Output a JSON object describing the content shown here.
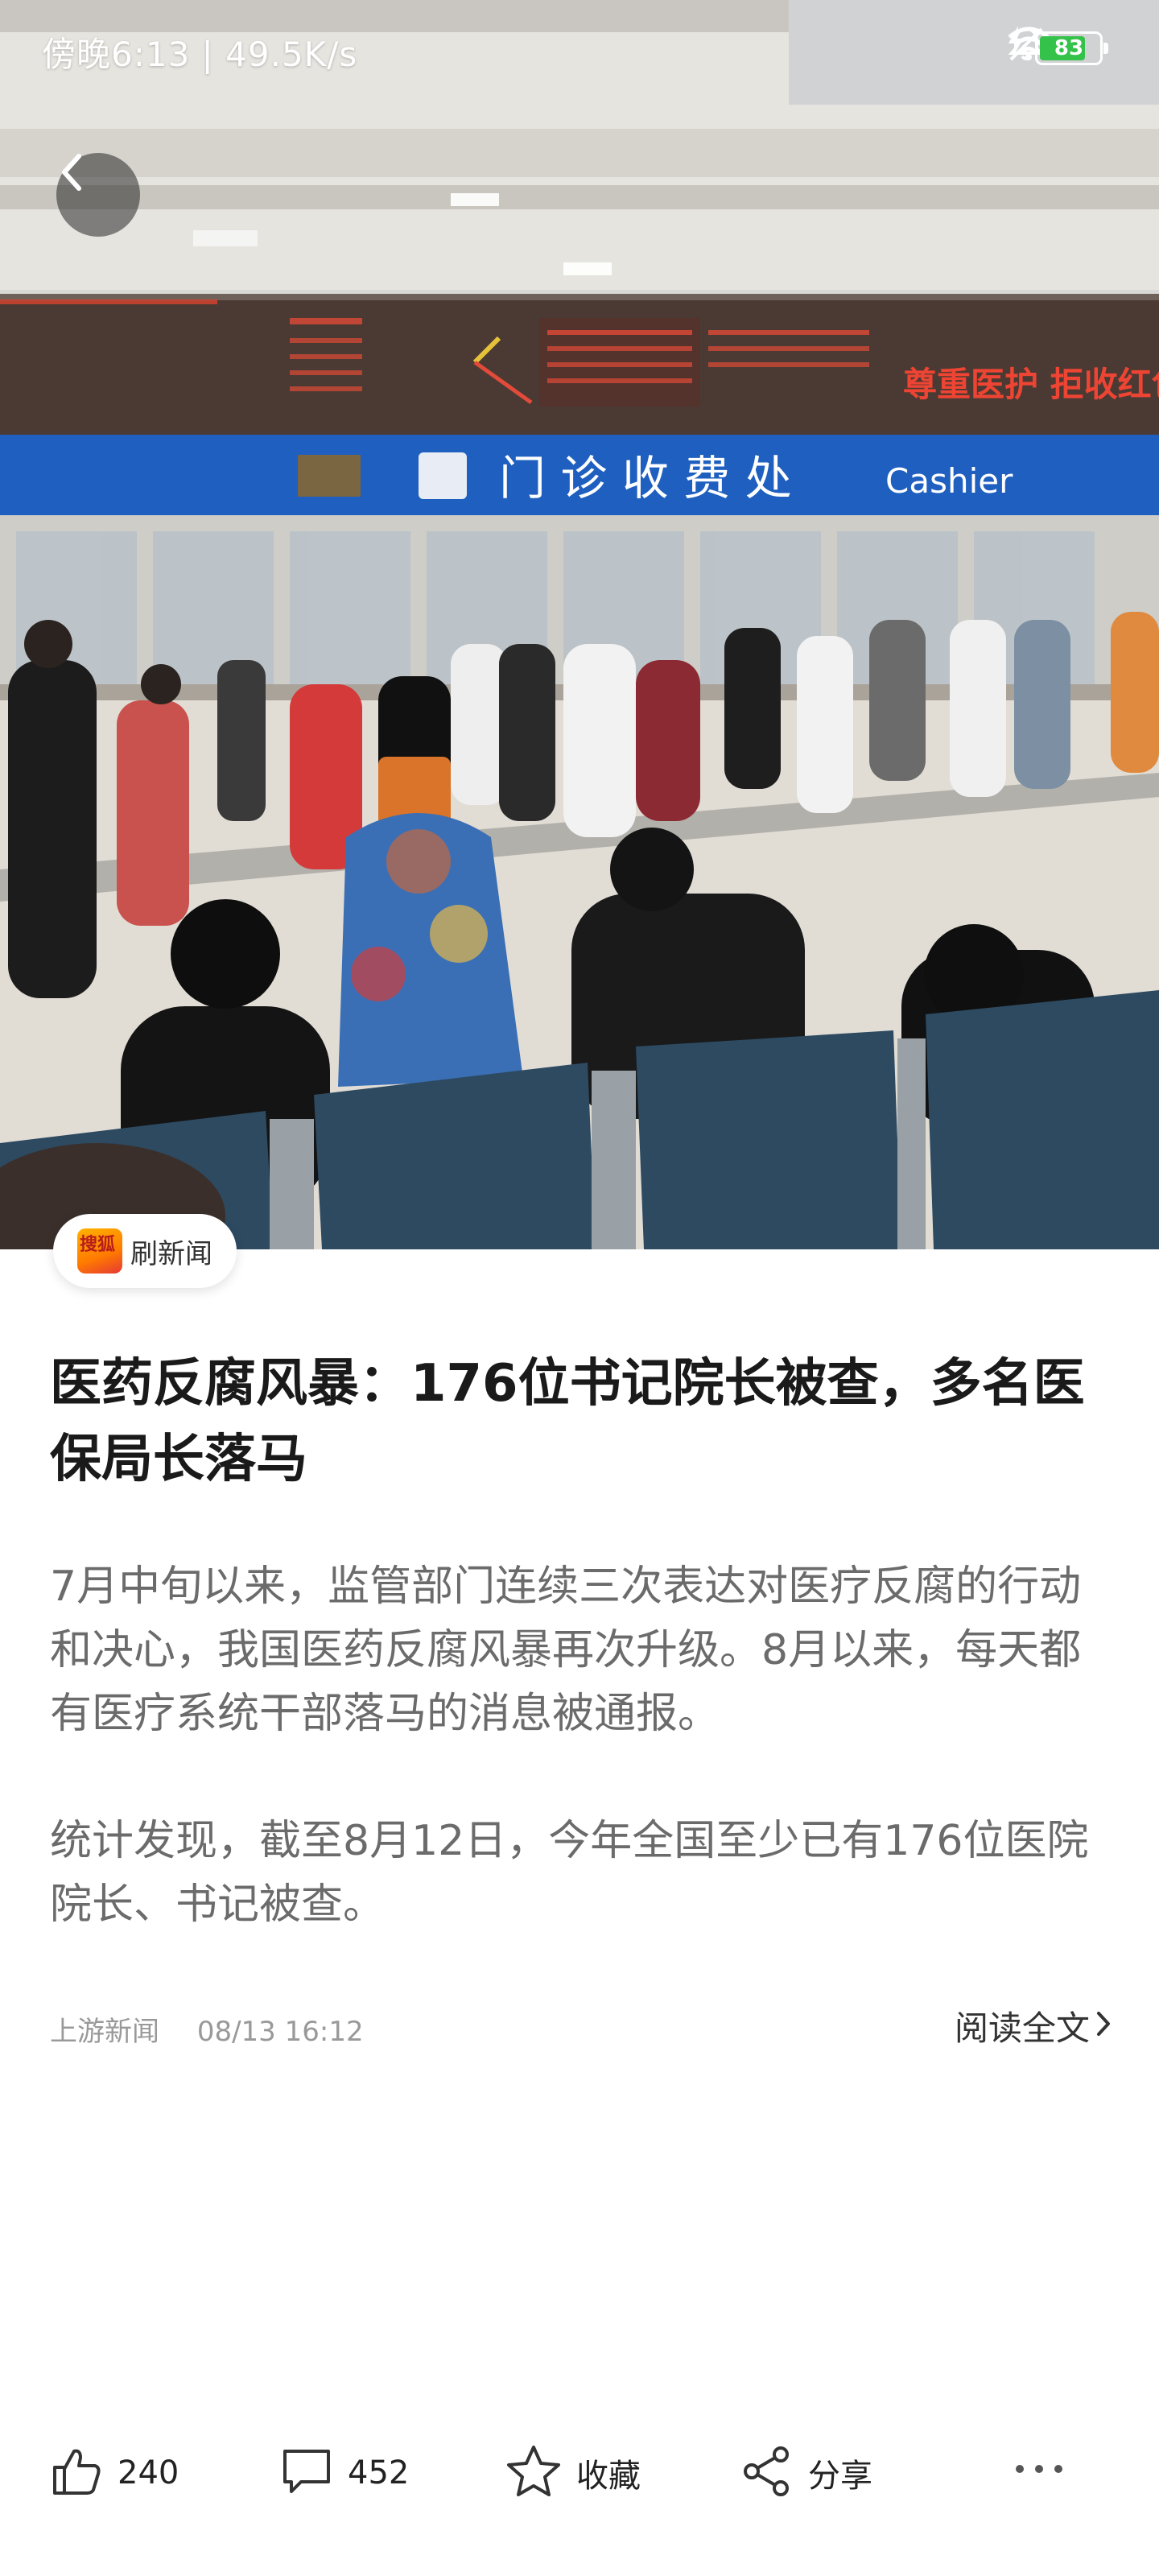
{
  "status_bar": {
    "left_text": "傍晚6:13 | 49.5K/s",
    "battery": "83",
    "icons": [
      "mute-icon",
      "wifi-icon",
      "battery-icon",
      "charging-icon"
    ]
  },
  "hero": {
    "image_description_icon": "hospital-cashier-hall-photo",
    "sign_text": "门 诊 收 费 处",
    "sign_text_en": "Cashier",
    "led_text_right": "尊重医护 拒收红包"
  },
  "back_button": {
    "icon": "back-arrow-icon"
  },
  "source": {
    "name": "刷新闻",
    "logo_text": "搜狐"
  },
  "article": {
    "title": "医药反腐风暴：176位书记院长被查，多名医保局长落马",
    "paragraphs": [
      "7月中旬以来，监管部门连续三次表达对医疗反腐的行动和决心，我国医药反腐风暴再次升级。8月以来，每天都有医疗系统干部落马的消息被通报。",
      "统计发现，截至8月12日，今年全国至少已有176位医院院长、书记被查。"
    ],
    "publisher": "上游新闻",
    "datetime": "08/13 16:12",
    "read_full_label": "阅读全文"
  },
  "actions": {
    "like_count": "240",
    "comment_count": "452",
    "favorite_label": "收藏",
    "share_label": "分享"
  }
}
